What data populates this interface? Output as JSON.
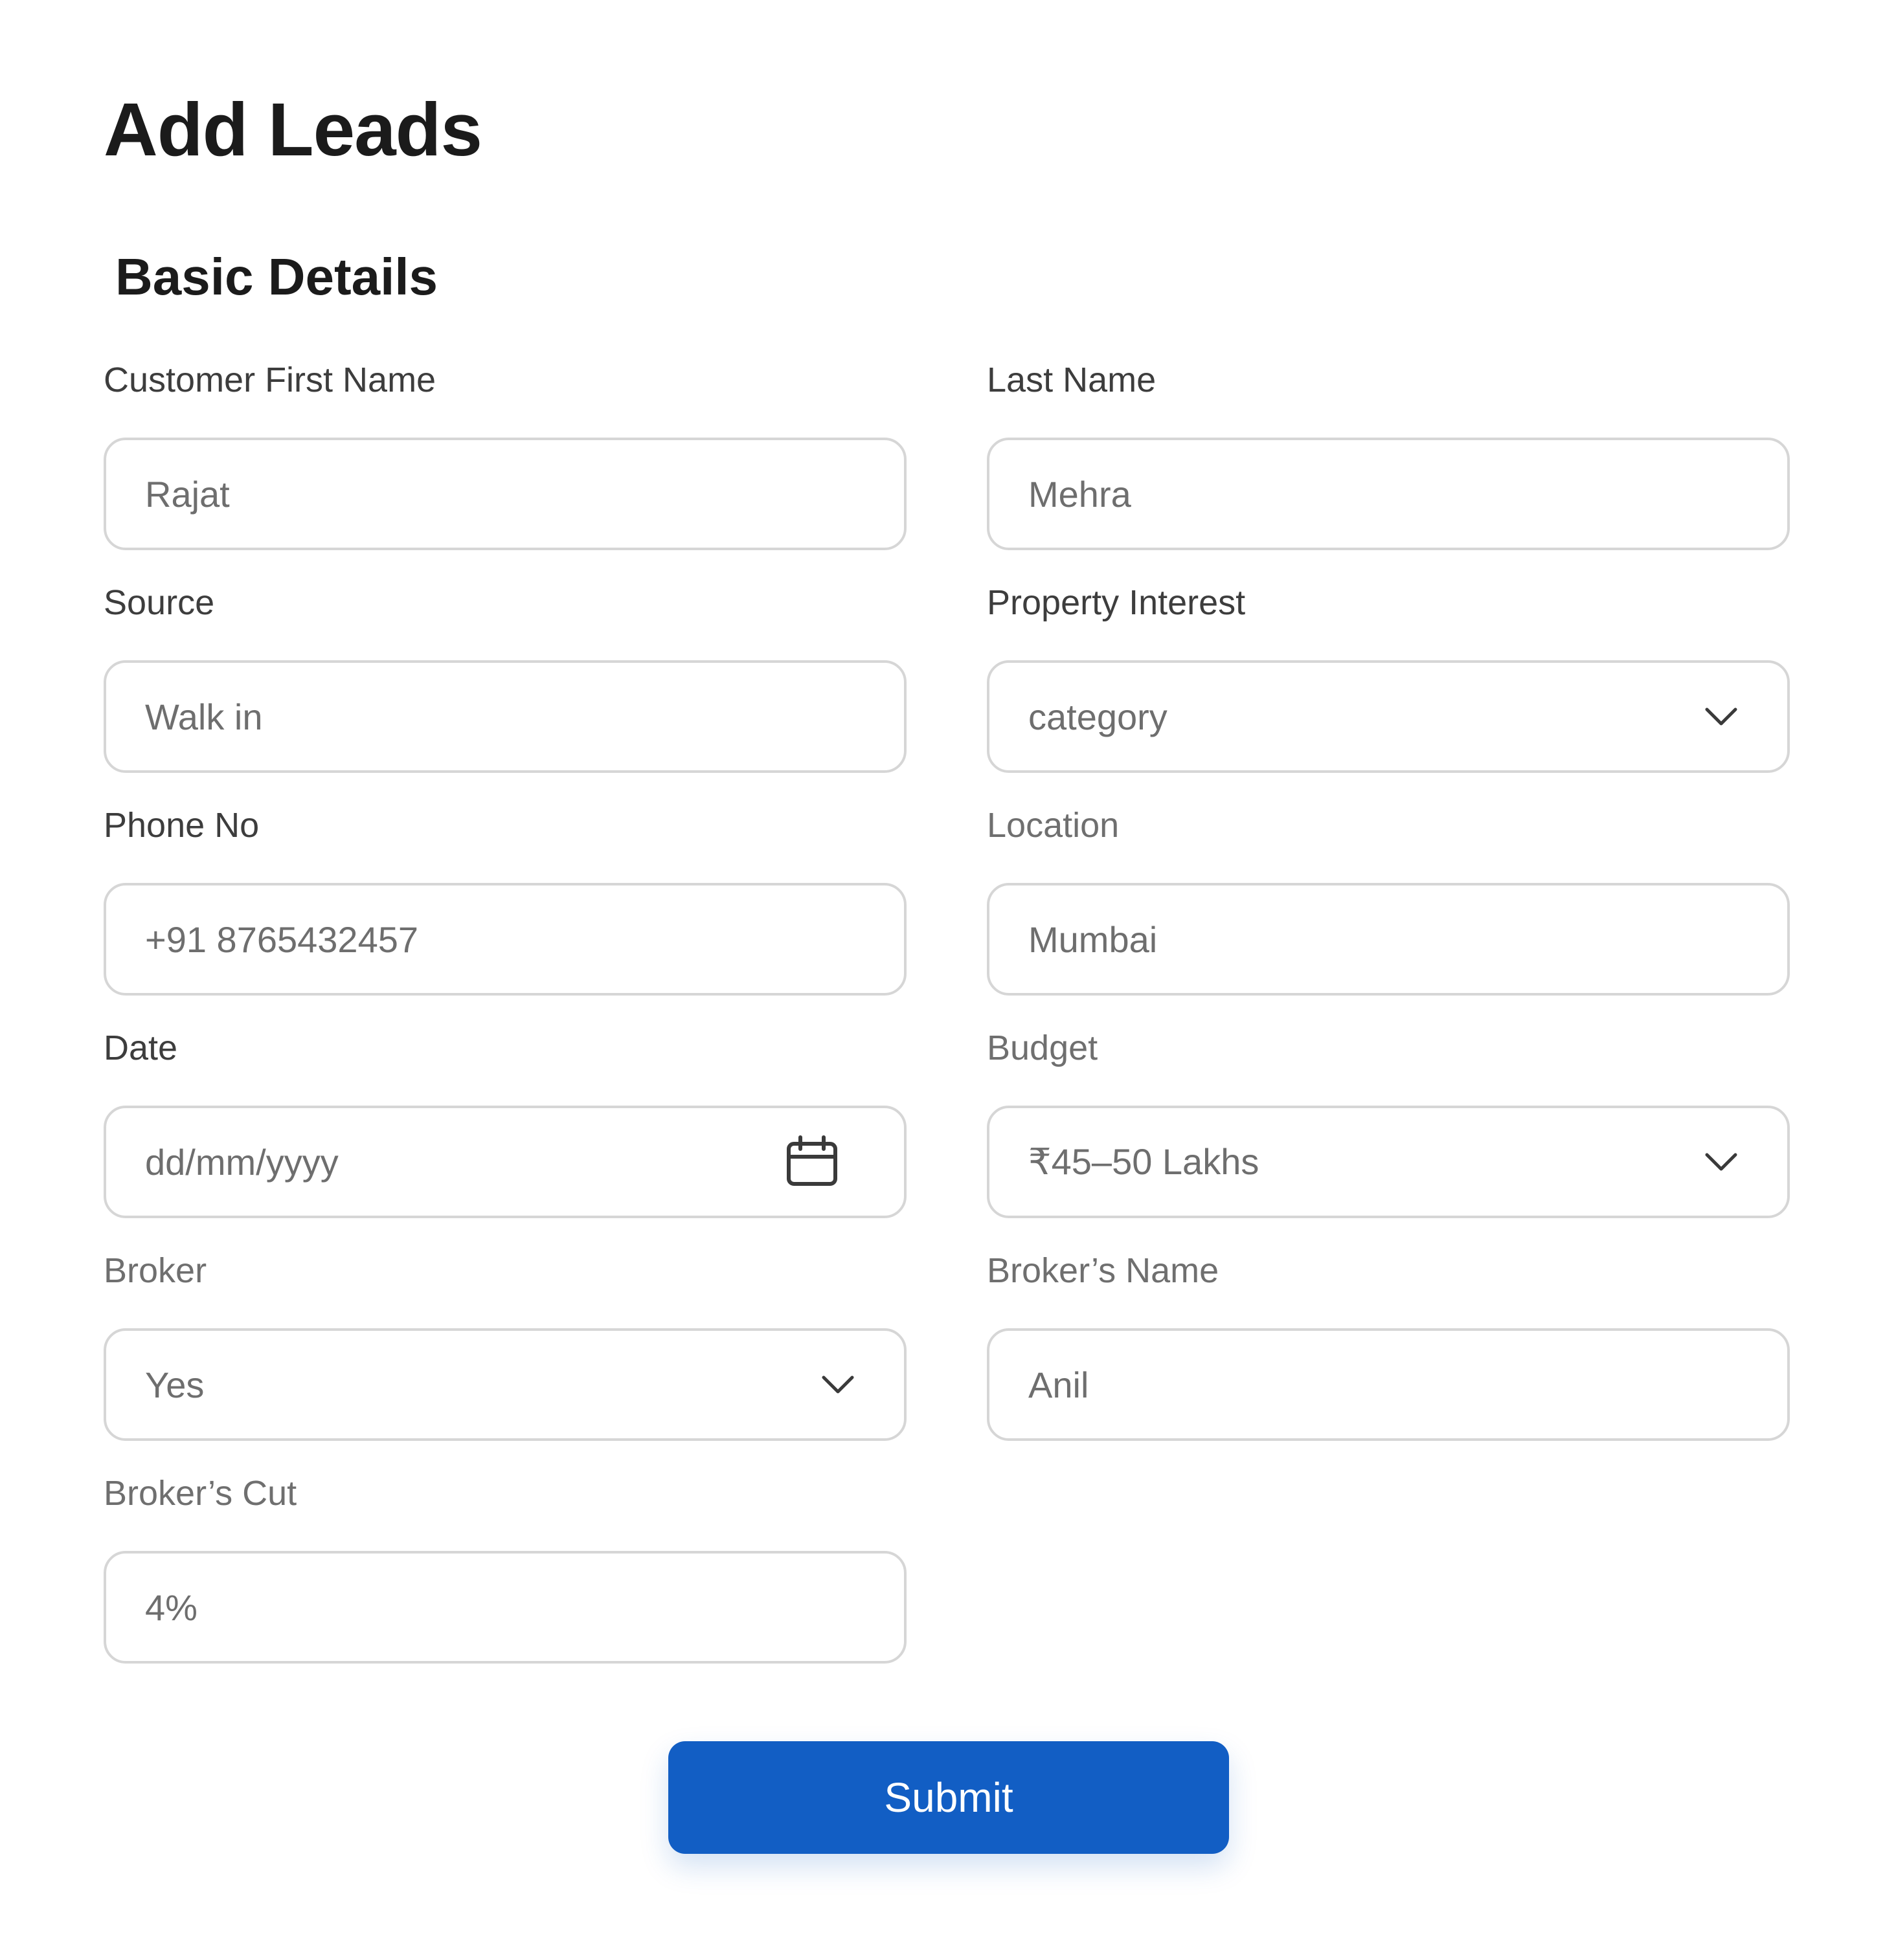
{
  "page_title": "Add Leads",
  "section_title": "Basic Details",
  "fields": {
    "first_name": {
      "label": "Customer First Name",
      "value": "Rajat"
    },
    "last_name": {
      "label": "Last Name",
      "value": "Mehra"
    },
    "source": {
      "label": "Source",
      "value": "Walk in"
    },
    "property_interest": {
      "label": "Property Interest",
      "value": "category",
      "icon": "chevron-down-icon"
    },
    "phone": {
      "label": "Phone No",
      "value": "+91 8765432457"
    },
    "location": {
      "label": "Location",
      "value": "Mumbai"
    },
    "date": {
      "label": "Date",
      "value": "dd/mm/yyyy",
      "icon": "calendar-icon"
    },
    "budget": {
      "label": "Budget",
      "value": "₹45–50 Lakhs",
      "icon": "chevron-down-icon"
    },
    "broker": {
      "label": "Broker",
      "value": "Yes",
      "icon": "chevron-down-icon"
    },
    "broker_name": {
      "label": "Broker’s Name",
      "value": "Anil"
    },
    "broker_cut": {
      "label": "Broker’s Cut",
      "value": "4%"
    }
  },
  "submit_label": "Submit",
  "colors": {
    "accent": "#125ec4",
    "border": "#d6d6d6",
    "label": "#3d3d3d",
    "label_muted": "#6f6f6f",
    "value": "#6e6e6e"
  }
}
